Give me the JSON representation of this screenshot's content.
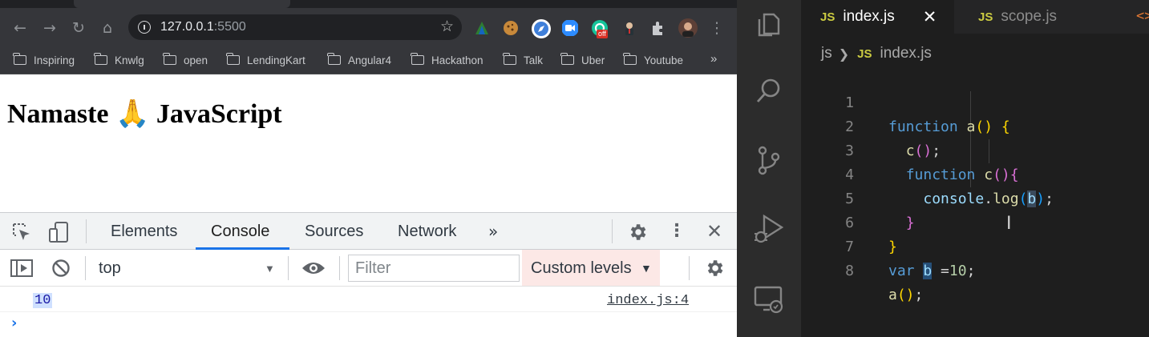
{
  "browser": {
    "address": {
      "host": "127.0.0.1",
      "port": ":5500"
    },
    "bookmarks": [
      "Inspiring",
      "Knwlg",
      "open",
      "LendingKart",
      "Angular4",
      "Hackathon",
      "Talk",
      "Uber",
      "Youtube"
    ],
    "bookmarks_more": "»",
    "extension_badge": "off",
    "page_heading": "Namaste 🙏 JavaScript"
  },
  "devtools": {
    "tabs": [
      "Elements",
      "Console",
      "Sources",
      "Network"
    ],
    "active_tab": "Console",
    "more_tabs": "»",
    "context": "top",
    "filter_placeholder": "Filter",
    "levels": "Custom levels",
    "log": {
      "value": "10",
      "source": "index.js:4"
    }
  },
  "vscode": {
    "tabs": [
      {
        "badge": "JS",
        "label": "index.js",
        "active": true
      },
      {
        "badge": "JS",
        "label": "scope.js",
        "active": false
      }
    ],
    "breadcrumb": {
      "folder": "js",
      "badge": "JS",
      "file": "index.js"
    },
    "line_numbers": [
      "1",
      "2",
      "3",
      "4",
      "5",
      "6",
      "7",
      "8"
    ],
    "code": {
      "kw_function": "function",
      "kw_var": "var",
      "fn_a": "a",
      "fn_c": "c",
      "console": "console",
      "log": "log",
      "var_b": "b",
      "num_10": "10"
    }
  }
}
